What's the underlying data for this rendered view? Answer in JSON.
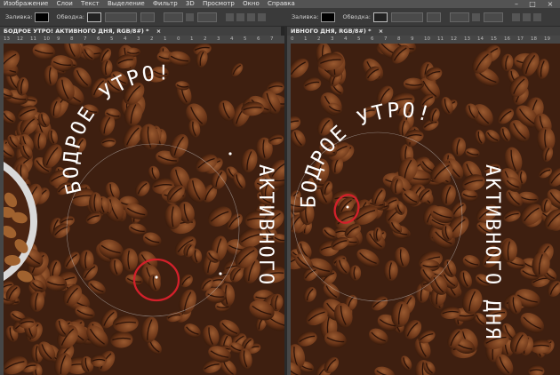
{
  "menu": {
    "items": [
      "Изображение",
      "Слои",
      "Текст",
      "Выделение",
      "Фильтр",
      "3D",
      "Просмотр",
      "Окно",
      "Справка"
    ],
    "window_controls": [
      "–",
      "□",
      "×"
    ]
  },
  "options": {
    "fill_label": "Заливка:",
    "stroke_label": "Обводка:",
    "fill_label_right": "Заливка:",
    "stroke_label_right": "Обводка:"
  },
  "tabs": {
    "left": "БОДРОЕ УТРО!  АКТИВНОГО ДНЯ, RGB/8#) *",
    "left_close": "×",
    "right": "ИВНОГО ДНЯ, RGB/8#) *",
    "right_close": "×"
  },
  "rulers": {
    "left": [
      "13",
      "12",
      "11",
      "10",
      "9",
      "8",
      "7",
      "6",
      "5",
      "4",
      "3",
      "2",
      "1",
      "0",
      "1",
      "2",
      "3",
      "4",
      "5",
      "6",
      "7"
    ],
    "right": [
      "0",
      "1",
      "2",
      "3",
      "4",
      "5",
      "6",
      "7",
      "8",
      "9",
      "10",
      "11",
      "12",
      "13",
      "14",
      "15",
      "16",
      "17",
      "18",
      "19"
    ]
  },
  "canvas": {
    "left": {
      "word_top": "БОДРОЕ УТРО!",
      "word_bottom": "АКТИВНОГО"
    },
    "right": {
      "word_top": "БОДРОЕ УТРО!",
      "word_bottom": "АКТИВНОГО ДНЯ"
    }
  },
  "colors": {
    "ui_dark": "#2b2b2b",
    "coffee_base": "#3e1f10",
    "bean_light": "#8a4d28",
    "highlight_circle": "#d3202a",
    "text": "#ffffff"
  }
}
